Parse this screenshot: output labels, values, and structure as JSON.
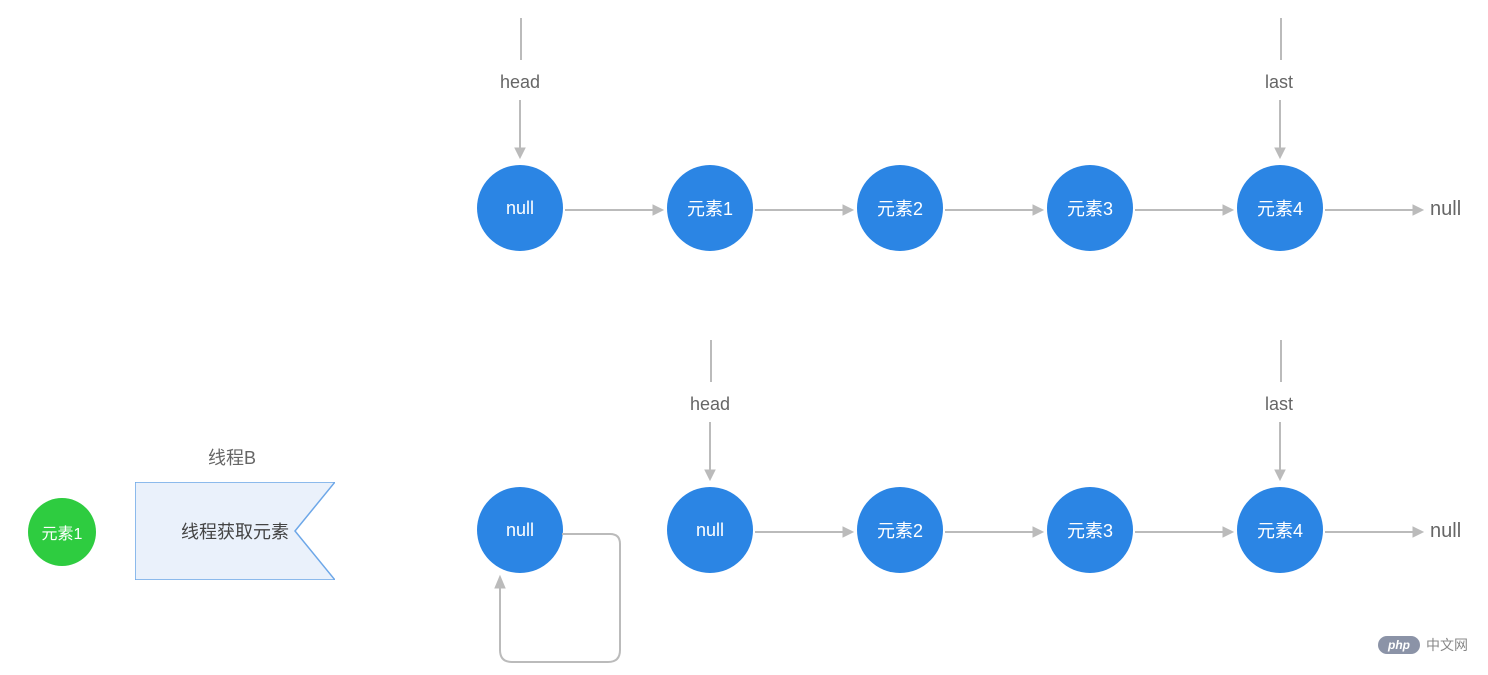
{
  "chart_data": {
    "type": "diagram",
    "title": "",
    "rows": [
      {
        "pointers": [
          {
            "label": "head",
            "targetIndex": 0
          },
          {
            "label": "last",
            "targetIndex": 4
          }
        ],
        "nodes": [
          "null",
          "元素1",
          "元素2",
          "元素3",
          "元素4"
        ],
        "terminal": "null"
      },
      {
        "pointers": [
          {
            "label": "head",
            "targetIndex": 1
          },
          {
            "label": "last",
            "targetIndex": 4
          }
        ],
        "nodes": [
          "null",
          "null",
          "元素2",
          "元素3",
          "元素4"
        ],
        "terminal": "null",
        "selfLoopIndex": 0
      }
    ],
    "threadOperation": {
      "thread": "线程B",
      "action": "线程获取元素",
      "result": "元素1"
    }
  },
  "labels": {
    "head_top": "head",
    "last_top": "last",
    "head_bottom": "head",
    "last_bottom": "last",
    "thread_name": "线程B",
    "thread_action": "线程获取元素",
    "result_element": "元素1",
    "null_end_top": "null",
    "null_end_bottom": "null"
  },
  "nodes": {
    "top": [
      "null",
      "元素1",
      "元素2",
      "元素3",
      "元素4"
    ],
    "bottom": [
      "null",
      "null",
      "元素2",
      "元素3",
      "元素4"
    ]
  },
  "watermark": {
    "badge": "php",
    "text": "中文网"
  }
}
